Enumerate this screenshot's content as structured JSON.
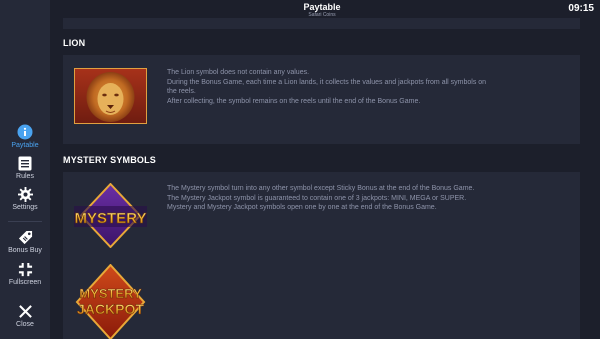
{
  "header": {
    "title": "Paytable",
    "subtitle": "Safari Coins",
    "time": "09:15"
  },
  "sidebar": {
    "items": [
      {
        "label": "Paytable",
        "icon": "info-icon",
        "active": true
      },
      {
        "label": "Rules",
        "icon": "rules-icon",
        "active": false
      },
      {
        "label": "Settings",
        "icon": "gear-icon",
        "active": false
      },
      {
        "label": "Bonus Buy",
        "icon": "bonus-buy-icon",
        "active": false
      },
      {
        "label": "Fullscreen",
        "icon": "fullscreen-icon",
        "active": false
      },
      {
        "label": "Close",
        "icon": "close-icon",
        "active": false
      }
    ]
  },
  "sections": {
    "lion": {
      "title": "LION",
      "lines": [
        "The Lion symbol does not contain any values.",
        "During the Bonus Game, each time a Lion lands, it collects the values and jackpots from all symbols on",
        "the reels.",
        "After collecting, the symbol remains on the reels until the end of the Bonus Game."
      ]
    },
    "mystery": {
      "title": "MYSTERY SYMBOLS",
      "lines": [
        "The Mystery symbol turn into any other symbol except Sticky Bonus at the end of the Bonus Game.",
        "The Mystery Jackpot symbol is guaranteed to contain one of 3 jackpots: MINI, MEGA or SUPER.",
        "Mystery and Mystery Jackpot symbols open one by one at the end of the Bonus Game."
      ],
      "symbol1_text": "MYSTERY",
      "symbol2_line1": "MYSTERY",
      "symbol2_line2": "JACKPOT"
    }
  },
  "colors": {
    "accent": "#4aa3f0",
    "background": "#1c1f2b",
    "panel": "#252938"
  }
}
